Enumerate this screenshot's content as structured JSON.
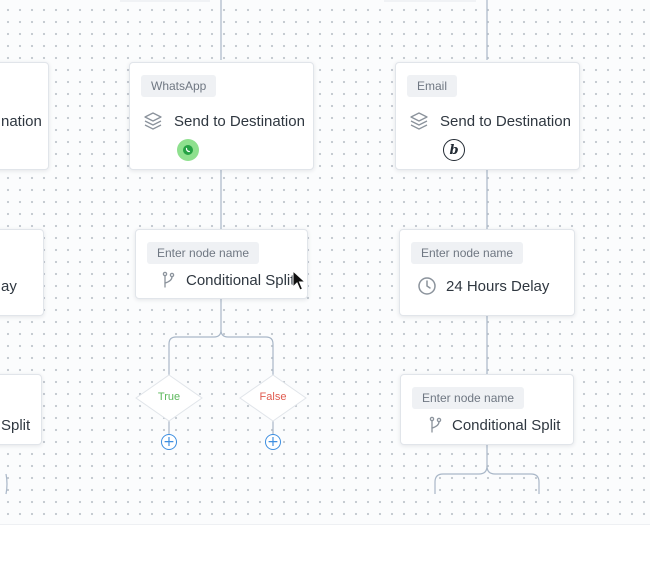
{
  "colors": {
    "connector": "#a9b7c8",
    "diamond_border": "#e1e5ea",
    "true_label": "#5cb85c",
    "false_label": "#e05b4f",
    "add_button": "#3d8ee0",
    "whatsapp_badge_bg": "#8ee08e",
    "whatsapp_icon": "#25a244"
  },
  "partial_left": {
    "destination_label_fragment": "nation",
    "delay_label_fragment": "ay",
    "split_label_fragment": "Split"
  },
  "middle": {
    "destination": {
      "tag": "WhatsApp",
      "label": "Send to Destination",
      "icon": "layers-icon",
      "badge_icon": "whatsapp-icon"
    },
    "split": {
      "placeholder": "Enter node name",
      "label": "Conditional Split",
      "icon": "branch-icon"
    },
    "branches": [
      {
        "label": "True",
        "add_icon": "plus-icon"
      },
      {
        "label": "False",
        "add_icon": "plus-icon"
      }
    ]
  },
  "right": {
    "destination": {
      "tag": "Email",
      "label": "Send to Destination",
      "icon": "layers-icon",
      "badge_icon": "brand-b-icon"
    },
    "delay": {
      "placeholder": "Enter node name",
      "label": "24 Hours Delay",
      "icon": "clock-icon"
    },
    "split": {
      "placeholder": "Enter node name",
      "label": "Conditional Split",
      "icon": "branch-icon"
    }
  }
}
